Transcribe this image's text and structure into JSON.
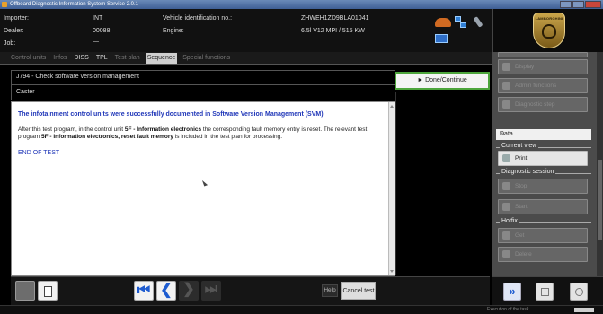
{
  "window": {
    "title": "Offboard Diagnostic Information System Service  2.0.1"
  },
  "header": {
    "importer_label": "Importer:",
    "importer_value": "INT",
    "dealer_label": "Dealer:",
    "dealer_value": "00088",
    "job_label": "Job:",
    "job_value": "—",
    "vin_label": "Vehicle identification no.:",
    "vin_value": "ZHWEH1ZD9BLA01041",
    "engine_label": "Engine:",
    "engine_value": "6.5l V12 MPI / 515 KW"
  },
  "logo": {
    "text": "LAMBORGHINI"
  },
  "tabs": [
    "Control units",
    "Infos",
    "DISS",
    "TPL",
    "Test plan",
    "Sequence",
    "Special functions"
  ],
  "test": {
    "title": "J794 - Check software version management",
    "subtitle": "Caster",
    "done_label": "► Done/Continue",
    "message": "The infotainment control units were successfully documented in Software Version Management (SVM).",
    "detail_p1": "After this test program, in the control unit ",
    "detail_b1": "5F - Information electronics",
    "detail_p2": " the corresponding fault memory entry is reset. The relevant test program ",
    "detail_b2": "5F - Information electronics, reset fault memory",
    "detail_p3": " is included in the test plan for processing.",
    "end": "END OF TEST"
  },
  "footer": {
    "first_glyph": "⏮",
    "prev_glyph": "❮",
    "next_glyph": "❯",
    "last_glyph": "⏭",
    "help_label": "Help",
    "cancel_label": "Cancel test"
  },
  "sidebar": {
    "top_buttons": [
      "Display",
      "Admin functions",
      "Diagnostic step"
    ],
    "data_label": "Data",
    "data_chevron": "»",
    "current_view_label": "Current view",
    "print_label": "Print",
    "diag_session_label": "Diagnostic session",
    "diag_btn1": "Stop",
    "diag_btn2": "Start",
    "hotfix_label": "Hotfix",
    "hotfix_btn1": "Get",
    "hotfix_btn2": "Delete",
    "forward_glyph": "»"
  },
  "status": {
    "text": "Execution of the task"
  },
  "icons": {
    "car": "car-icon",
    "network": "network-icon",
    "plug": "plug-icon",
    "vas": "vas-interface-icon"
  }
}
